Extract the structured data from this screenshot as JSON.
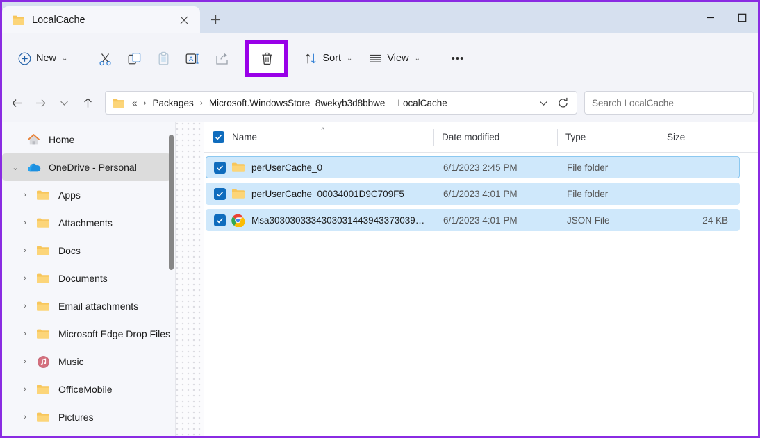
{
  "window": {
    "highlight_color": "#9900e8",
    "titlebar_bg": "#d6e0ef",
    "accent_color": "#0f6cbd"
  },
  "tab": {
    "title": "LocalCache",
    "close_label": "✕",
    "new_tab_label": "+",
    "folder_icon": "folder-icon"
  },
  "window_controls": {
    "minimize": "—",
    "maximize": "▢"
  },
  "toolbar": {
    "new_label": "New",
    "new_icon": "plus-circle-icon",
    "cut_icon": "scissors-icon",
    "copy_icon": "copy-icon",
    "paste_icon": "clipboard-icon",
    "rename_icon": "rename-icon",
    "share_icon": "share-icon",
    "delete_icon": "trash-icon",
    "sort_label": "Sort",
    "sort_icon": "sort-arrows-icon",
    "view_label": "View",
    "view_icon": "view-lines-icon",
    "more_label": "•••",
    "chevron": "⌄"
  },
  "navbar": {
    "back_icon": "arrow-left-icon",
    "forward_icon": "arrow-right-icon",
    "recent_icon": "chevron-down-icon",
    "up_icon": "arrow-up-icon",
    "refresh_icon": "refresh-icon",
    "dropdown_icon": "chevron-down-icon",
    "breadcrumb_icon": "folder-icon",
    "breadcrumb": [
      {
        "label": "«",
        "separator": ""
      },
      {
        "label": "Packages",
        "separator": "›"
      },
      {
        "label": "Microsoft.WindowsStore_8wekyb3d8bbwe",
        "separator": "›"
      },
      {
        "label": "LocalCache",
        "separator": ""
      }
    ]
  },
  "search": {
    "placeholder": "Search LocalCache",
    "value": ""
  },
  "sidebar": {
    "items": [
      {
        "label": "Home",
        "icon": "home-icon",
        "expander": "",
        "indent": false,
        "selected": false
      },
      {
        "label": "OneDrive - Personal",
        "icon": "onedrive-cloud-icon",
        "expander": "⌄",
        "indent": false,
        "selected": true
      },
      {
        "label": "Apps",
        "icon": "folder-icon",
        "expander": "›",
        "indent": true,
        "selected": false
      },
      {
        "label": "Attachments",
        "icon": "folder-icon",
        "expander": "›",
        "indent": true,
        "selected": false
      },
      {
        "label": "Docs",
        "icon": "folder-icon",
        "expander": "›",
        "indent": true,
        "selected": false
      },
      {
        "label": "Documents",
        "icon": "folder-icon",
        "expander": "›",
        "indent": true,
        "selected": false
      },
      {
        "label": "Email attachments",
        "icon": "folder-icon",
        "expander": "›",
        "indent": true,
        "selected": false
      },
      {
        "label": "Microsoft Edge Drop Files",
        "icon": "folder-icon",
        "expander": "›",
        "indent": true,
        "selected": false
      },
      {
        "label": "Music",
        "icon": "music-note-icon",
        "expander": "›",
        "indent": true,
        "selected": false
      },
      {
        "label": "OfficeMobile",
        "icon": "folder-icon",
        "expander": "›",
        "indent": true,
        "selected": false
      },
      {
        "label": "Pictures",
        "icon": "folder-icon",
        "expander": "›",
        "indent": true,
        "selected": false
      }
    ]
  },
  "filelist": {
    "columns": [
      {
        "label": "Name",
        "key": "name"
      },
      {
        "label": "Date modified",
        "key": "date"
      },
      {
        "label": "Type",
        "key": "type"
      },
      {
        "label": "Size",
        "key": "size"
      }
    ],
    "select_all_checked": true,
    "sort_indicator": "^",
    "rows": [
      {
        "name": "perUserCache_0",
        "date": "6/1/2023 2:45 PM",
        "type": "File folder",
        "size": "",
        "icon": "folder-icon",
        "checked": true,
        "focused": true
      },
      {
        "name": "perUserCache_00034001D9C709F5",
        "date": "6/1/2023 4:01 PM",
        "type": "File folder",
        "size": "",
        "icon": "folder-icon",
        "checked": true,
        "focused": false
      },
      {
        "name": "Msa3030303334303031443943373039…",
        "date": "6/1/2023 4:01 PM",
        "type": "JSON File",
        "size": "24 KB",
        "icon": "chrome-icon",
        "checked": true,
        "focused": false
      }
    ]
  }
}
